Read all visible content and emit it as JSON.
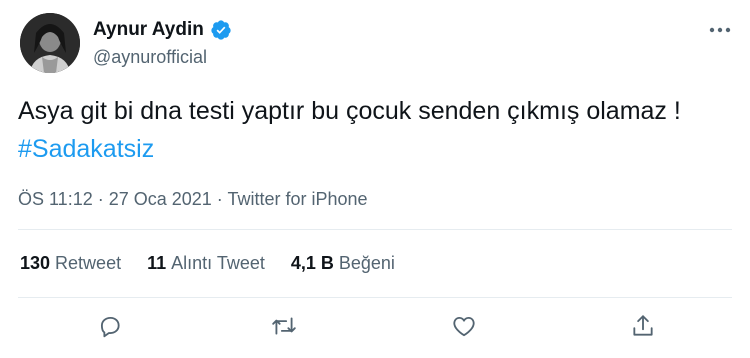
{
  "tweet": {
    "author": {
      "display_name": "Aynur Aydin",
      "handle": "@aynurofficial",
      "verified": true
    },
    "text_plain": "Asya git bi dna testi yaptır bu çocuk senden çıkmış olamaz ! ",
    "hashtag": "#Sadakatsiz",
    "meta": "ÖS 11:12 · 27 Oca 2021 · Twitter for iPhone",
    "stats": {
      "retweets_count": "130",
      "retweets_label": "Retweet",
      "quotes_count": "11",
      "quotes_label": "Alıntı Tweet",
      "likes_count": "4,1 B",
      "likes_label": "Beğeni"
    },
    "actions": [
      "reply-icon",
      "retweet-icon",
      "like-icon",
      "share-icon"
    ],
    "colors": {
      "accent": "#1d9bf0",
      "secondary_text": "#536471",
      "primary_text": "#0f1419",
      "divider": "#e6ecf0"
    }
  }
}
